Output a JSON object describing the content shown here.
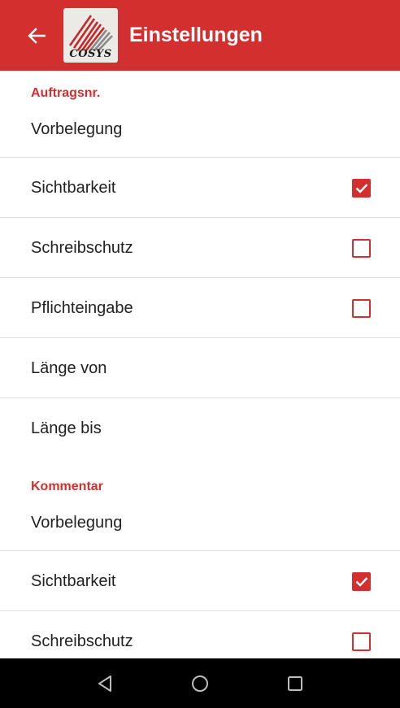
{
  "appbar": {
    "title": "Einstellungen",
    "logo_text": "COSYS",
    "back_icon": "arrow-back-icon",
    "accent_color": "#d32f2f"
  },
  "sections": [
    {
      "header": "Auftragsnr.",
      "items": [
        {
          "label": "Vorbelegung",
          "type": "text"
        },
        {
          "label": "Sichtbarkeit",
          "type": "checkbox",
          "checked": true
        },
        {
          "label": "Schreibschutz",
          "type": "checkbox",
          "checked": false
        },
        {
          "label": "Pflichteingabe",
          "type": "checkbox",
          "checked": false
        },
        {
          "label": "Länge von",
          "type": "text"
        },
        {
          "label": "Länge bis",
          "type": "text"
        }
      ]
    },
    {
      "header": "Kommentar",
      "items": [
        {
          "label": "Vorbelegung",
          "type": "text"
        },
        {
          "label": "Sichtbarkeit",
          "type": "checkbox",
          "checked": true
        },
        {
          "label": "Schreibschutz",
          "type": "checkbox",
          "checked": false
        }
      ]
    }
  ],
  "navbar": {
    "icons": [
      "back-triangle-icon",
      "home-circle-icon",
      "recents-square-icon"
    ]
  }
}
